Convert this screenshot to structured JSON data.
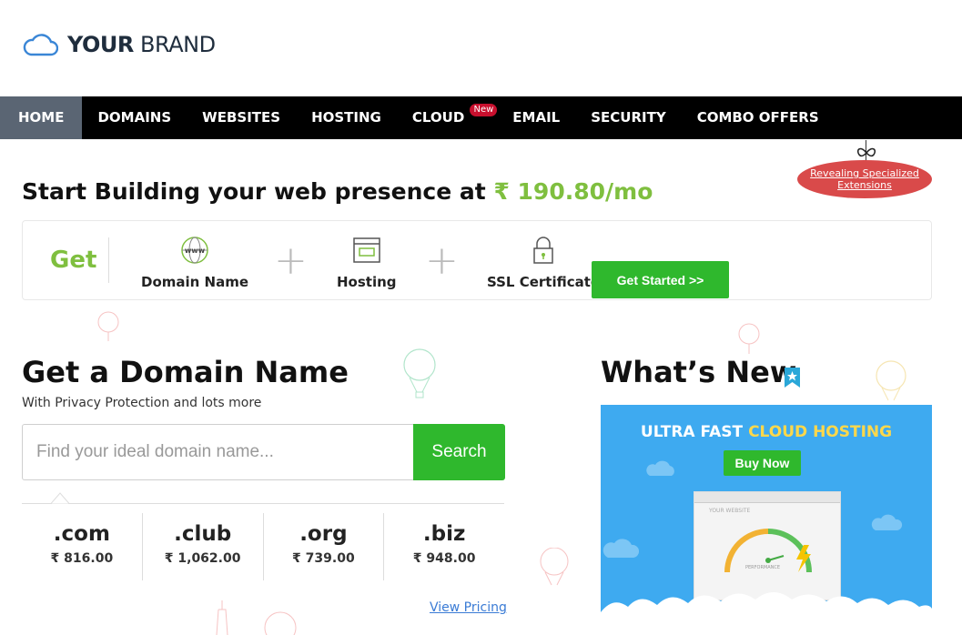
{
  "brand": {
    "name_bold": "YOUR",
    "name_light": " BRAND"
  },
  "nav": {
    "items": [
      {
        "label": "HOME"
      },
      {
        "label": "DOMAINS"
      },
      {
        "label": "WEBSITES"
      },
      {
        "label": "HOSTING"
      },
      {
        "label": "CLOUD",
        "badge": "New"
      },
      {
        "label": "EMAIL"
      },
      {
        "label": "SECURITY"
      },
      {
        "label": "COMBO OFFERS"
      }
    ]
  },
  "reveal_tag": {
    "line1": "Revealing Specialized",
    "line2": "Extensions"
  },
  "headline": {
    "text": "Start Building your web presence at ",
    "price": "₹ 190.80/mo"
  },
  "get_box": {
    "label": "Get",
    "items": [
      {
        "label": "Domain Name",
        "icon": "www-globe-icon"
      },
      {
        "label": "Hosting",
        "icon": "server-window-icon"
      },
      {
        "label": "SSL Certificate",
        "icon": "padlock-icon"
      }
    ],
    "button": "Get Started >>"
  },
  "domain_section": {
    "title": "Get a Domain Name",
    "subtitle": "With Privacy Protection and lots more",
    "placeholder": "Find your ideal domain name...",
    "search_button": "Search",
    "tlds": [
      {
        "ext": ".com",
        "price": "₹ 816.00"
      },
      {
        "ext": ".club",
        "price": "₹ 1,062.00"
      },
      {
        "ext": ".org",
        "price": "₹ 739.00"
      },
      {
        "ext": ".biz",
        "price": "₹ 948.00"
      }
    ],
    "view_pricing": "View Pricing"
  },
  "whats_new": {
    "title": "What’s New",
    "promo_prefix": "ULTRA FAST ",
    "promo_highlight": "CLOUD HOSTING",
    "buy_now": "Buy Now",
    "browser_site": "YOUR WEBSITE",
    "browser_perf": "PERFORMANCE"
  },
  "colors": {
    "accent_green": "#7fbf3f",
    "button_green": "#2fb82d",
    "nav_bg": "#000000",
    "promo_bg": "#3eaaf0",
    "tag_red": "#d94a4a"
  }
}
